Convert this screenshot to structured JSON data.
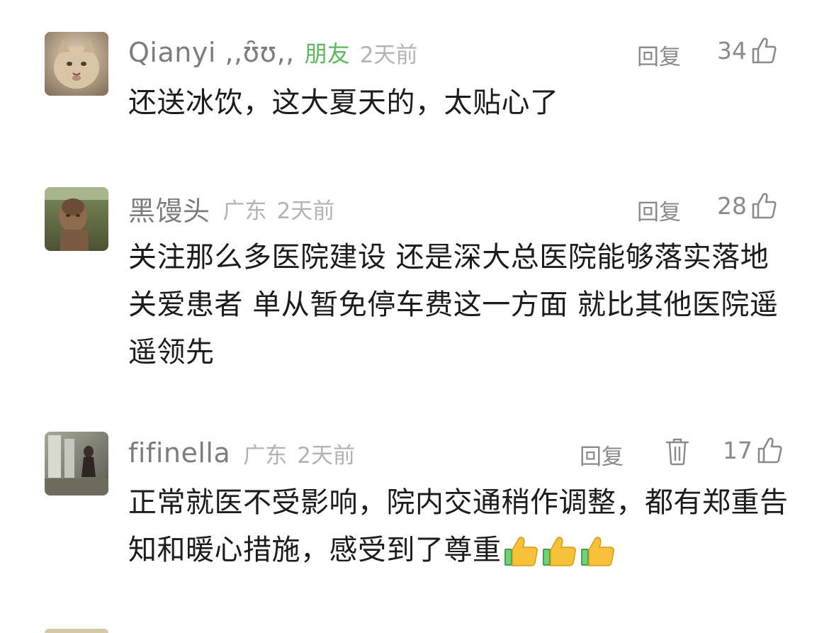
{
  "comments": [
    {
      "username": "Qianyi ,,ʘ̬ʘ,,",
      "username_display": "Qianyi ,,ʊ̑ʊ,,",
      "tag": "朋友",
      "location": "",
      "time": "2天前",
      "reply_label": "回复",
      "likes": "34",
      "body": "还送冰饮，这大夏天的，太贴心了",
      "avatar_icon": "cat-avatar"
    },
    {
      "username": "黑馒头",
      "tag": "",
      "location": "广东",
      "time": "2天前",
      "reply_label": "回复",
      "likes": "28",
      "body": "关注那么多医院建设 还是深大总医院能够落实落地关爱患者 单从暂免停车费这一方面 就比其他医院遥遥领先",
      "avatar_icon": "statue-avatar"
    },
    {
      "username": "fifinella",
      "tag": "",
      "location": "广东",
      "time": "2天前",
      "reply_label": "回复",
      "likes": "17",
      "body": "正常就医不受影响，院内交通稍作调整，都有郑重告知和暖心措施，感受到了尊重",
      "avatar_icon": "photo-avatar",
      "has_delete": true,
      "emoji": "thumbs-up-emoji x3"
    }
  ],
  "colors": {
    "username": "#7d7d7d",
    "friend_tag": "#5cb85c",
    "meta": "#b3b3b3",
    "action": "#8a8a8a",
    "body": "#1c1c1c"
  }
}
